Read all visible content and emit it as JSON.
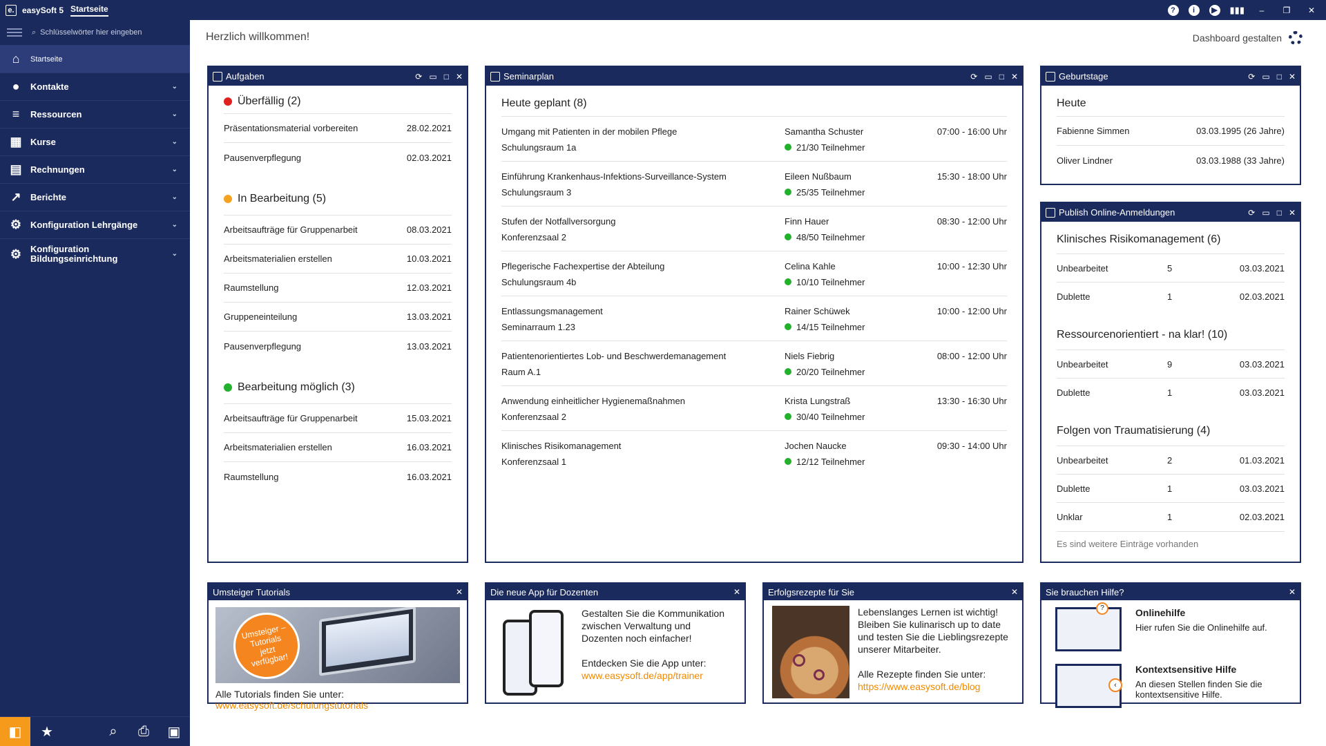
{
  "titlebar": {
    "logo": "e.",
    "app": "easySoft 5",
    "tab": "Startseite",
    "icons": [
      "help-icon",
      "info-icon",
      "play-icon",
      "signal-icon"
    ],
    "window": [
      "–",
      "❐",
      "✕"
    ]
  },
  "sidebar": {
    "search_placeholder": "Schlüsselwörter hier eingeben",
    "items": [
      {
        "label": "Startseite",
        "icon": "home-icon"
      },
      {
        "label": "Kontakte",
        "icon": "person-icon"
      },
      {
        "label": "Ressourcen",
        "icon": "database-icon"
      },
      {
        "label": "Kurse",
        "icon": "grid-icon"
      },
      {
        "label": "Rechnungen",
        "icon": "calculator-icon"
      },
      {
        "label": "Berichte",
        "icon": "chart-icon"
      },
      {
        "label": "Konfiguration Lehrgänge",
        "icon": "config-icon"
      },
      {
        "label": "Konfiguration Bildungseinrichtung",
        "icon": "config-building-icon"
      }
    ],
    "bottom": [
      "layout-icon",
      "star-icon",
      "search-window-icon",
      "print-icon",
      "contact-card-icon"
    ]
  },
  "main": {
    "welcome": "Herzlich willkommen!",
    "dashboard_config": "Dashboard gestalten"
  },
  "aufgaben": {
    "title": "Aufgaben",
    "groups": [
      {
        "label": "Überfällig (2)",
        "color": "#e0201e",
        "rows": [
          {
            "task": "Präsentationsmaterial vorbereiten",
            "date": "28.02.2021"
          },
          {
            "task": "Pausenverpflegung",
            "date": "02.03.2021"
          }
        ]
      },
      {
        "label": "In Bearbeitung (5)",
        "color": "#f5a21f",
        "rows": [
          {
            "task": "Arbeitsaufträge für Gruppenarbeit",
            "date": "08.03.2021"
          },
          {
            "task": "Arbeitsmaterialien erstellen",
            "date": "10.03.2021"
          },
          {
            "task": "Raumstellung",
            "date": "12.03.2021"
          },
          {
            "task": "Gruppeneinteilung",
            "date": "13.03.2021"
          },
          {
            "task": "Pausenverpflegung",
            "date": "13.03.2021"
          }
        ]
      },
      {
        "label": "Bearbeitung möglich (3)",
        "color": "#22b02d",
        "rows": [
          {
            "task": "Arbeitsaufträge für Gruppenarbeit",
            "date": "15.03.2021"
          },
          {
            "task": "Arbeitsmaterialien erstellen",
            "date": "16.03.2021"
          },
          {
            "task": "Raumstellung",
            "date": "16.03.2021"
          }
        ]
      }
    ]
  },
  "seminarplan": {
    "title": "Seminarplan",
    "heading": "Heute geplant (8)",
    "rows": [
      {
        "name": "Umgang mit Patienten in der mobilen Pflege",
        "room": "Schulungsraum 1a",
        "trainer": "Samantha Schuster",
        "participants": "21/30 Teilnehmer",
        "time": "07:00 - 16:00 Uhr"
      },
      {
        "name": "Einführung Krankenhaus-Infektions-Surveillance-System",
        "room": "Schulungsraum 3",
        "trainer": "Eileen Nußbaum",
        "participants": "25/35 Teilnehmer",
        "time": "15:30 - 18:00 Uhr"
      },
      {
        "name": "Stufen der Notfallversorgung",
        "room": "Konferenzsaal 2",
        "trainer": "Finn Hauer",
        "participants": "48/50 Teilnehmer",
        "time": "08:30 - 12:00 Uhr"
      },
      {
        "name": "Pflegerische Fachexpertise der Abteilung",
        "room": "Schulungsraum 4b",
        "trainer": "Celina Kahle",
        "participants": "10/10 Teilnehmer",
        "time": "10:00 - 12:30 Uhr"
      },
      {
        "name": "Entlassungsmanagement",
        "room": "Seminarraum 1.23",
        "trainer": "Rainer Schüwek",
        "participants": "14/15 Teilnehmer",
        "time": "10:00 - 12:00 Uhr"
      },
      {
        "name": "Patientenorientiertes Lob- und Beschwerdemanagement",
        "room": "Raum A.1",
        "trainer": "Niels Fiebrig",
        "participants": "20/20 Teilnehmer",
        "time": "08:00 - 12:00 Uhr"
      },
      {
        "name": "Anwendung einheitlicher Hygienemaßnahmen",
        "room": "Konferenzsaal 2",
        "trainer": "Krista Lungstraß",
        "participants": "30/40 Teilnehmer",
        "time": "13:30 - 16:30 Uhr"
      },
      {
        "name": "Klinisches Risikomanagement",
        "room": "Konferenzsaal 1",
        "trainer": "Jochen Naucke",
        "participants": "12/12 Teilnehmer",
        "time": "09:30 - 14:00 Uhr"
      }
    ]
  },
  "geburtstage": {
    "title": "Geburtstage",
    "heading": "Heute",
    "rows": [
      {
        "name": "Fabienne Simmen",
        "date": "03.03.1995 (26 Jahre)"
      },
      {
        "name": "Oliver Lindner",
        "date": "03.03.1988 (33 Jahre)"
      }
    ]
  },
  "publish": {
    "title": "Publish Online-Anmeldungen",
    "groups": [
      {
        "label": "Klinisches Risikomanagement (6)",
        "rows": [
          {
            "status": "Unbearbeitet",
            "count": "5",
            "date": "03.03.2021"
          },
          {
            "status": "Dublette",
            "count": "1",
            "date": "02.03.2021"
          }
        ]
      },
      {
        "label": "Ressourcenorientiert - na klar! (10)",
        "rows": [
          {
            "status": "Unbearbeitet",
            "count": "9",
            "date": "03.03.2021"
          },
          {
            "status": "Dublette",
            "count": "1",
            "date": "03.03.2021"
          }
        ]
      },
      {
        "label": "Folgen von Traumatisierung (4)",
        "rows": [
          {
            "status": "Unbearbeitet",
            "count": "2",
            "date": "01.03.2021"
          },
          {
            "status": "Dublette",
            "count": "1",
            "date": "03.03.2021"
          },
          {
            "status": "Unklar",
            "count": "1",
            "date": "02.03.2021"
          }
        ]
      }
    ],
    "more": "Es sind weitere Einträge vorhanden"
  },
  "tutorials": {
    "title": "Umsteiger Tutorials",
    "badge": "Umsteiger – Tutorials jetzt verfügbar!",
    "text": "Alle Tutorials finden Sie unter:",
    "link": "www.easysoft.de/schulungstutorials"
  },
  "app": {
    "title": "Die neue App für Dozenten",
    "text": "Gestalten Sie die Kommunikation zwischen Verwaltung und Dozenten noch einfacher!",
    "text2": "Entdecken Sie die App unter:",
    "link": "www.easysoft.de/app/trainer"
  },
  "rezepte": {
    "title": "Erfolgsrezepte für Sie",
    "text": "Lebenslanges Lernen ist wichtig! Bleiben Sie kulinarisch up to date und testen Sie die Lieblingsrezepte unserer Mitarbeiter.",
    "text2": "Alle Rezepte finden Sie unter:",
    "link": "https://www.easysoft.de/blog"
  },
  "hilfe": {
    "title": "Sie brauchen Hilfe?",
    "items": [
      {
        "heading": "Onlinehilfe",
        "text": "Hier rufen Sie die Onlinehilfe auf."
      },
      {
        "heading": "Kontextsensitive Hilfe",
        "text": "An diesen Stellen finden Sie die kontextsensitive Hilfe."
      }
    ]
  },
  "colors": {
    "navy": "#1b2a5c",
    "accent": "#f59a1b",
    "link": "#f08a00"
  }
}
